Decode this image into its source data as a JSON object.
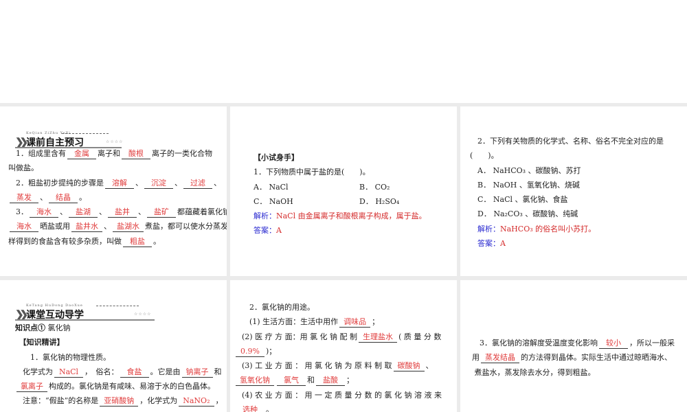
{
  "panels": [
    {
      "id": "preview",
      "header": {
        "pinyin": "KeQian ZiZhu YuXi",
        "title": "课前自主预习",
        "stars": "☆☆☆☆"
      },
      "lines": [
        [
          {
            "t": "　1．组成里含有"
          },
          {
            "b": "金属"
          },
          {
            "t": "离子和"
          },
          {
            "b": "酸根"
          },
          {
            "t": "离子的一类化合物"
          }
        ],
        [
          {
            "t": "叫做盐。"
          }
        ],
        [
          {
            "t": "　2．粗盐初步提纯的步骤是"
          },
          {
            "b": "溶解"
          },
          {
            "t": "、"
          },
          {
            "b": "沉淀"
          },
          {
            "t": "、"
          },
          {
            "b": "过滤"
          },
          {
            "t": "、"
          }
        ],
        [
          {
            "b": "蒸发"
          },
          {
            "t": "、"
          },
          {
            "b": "结晶"
          },
          {
            "t": "。"
          }
        ],
        [
          {
            "t": "　3．"
          },
          {
            "b": "海水"
          },
          {
            "t": "、"
          },
          {
            "b": "盐湖"
          },
          {
            "t": "、"
          },
          {
            "b": "盐井"
          },
          {
            "t": "、"
          },
          {
            "b": "盐矿"
          },
          {
            "t": "都蕴藏着氯化钠，用"
          }
        ],
        [
          {
            "b": "海水"
          },
          {
            "t": "晒盐或用"
          },
          {
            "b": "盐井水"
          },
          {
            "t": "、"
          },
          {
            "b": "盐湖水"
          },
          {
            "t": "煮盐，都可以使水分蒸发，这"
          }
        ],
        [
          {
            "t": "样得到的食盐含有较多杂质，叫做"
          },
          {
            "b": "粗盐"
          },
          {
            "t": "。"
          }
        ]
      ]
    },
    {
      "id": "practice-1",
      "lines": [
        [
          {
            "t": "【小试身手】",
            "c": "bold"
          }
        ],
        [
          {
            "t": "1．下列物质中属于盐的是(　　)。"
          }
        ],
        [
          {
            "t": "A． NaCl"
          },
          {
            "t": "B． CO₂",
            "tab": true
          }
        ],
        [
          {
            "t": "C． NaOH"
          },
          {
            "t": "D． H₂SO₄",
            "tab": true
          }
        ],
        [
          {
            "t": "解析：",
            "c": "blue"
          },
          {
            "t": "NaCl 由金属离子和酸根离子构成，属于盐。",
            "c": "red"
          }
        ],
        [
          {
            "t": "答案：",
            "c": "blue"
          },
          {
            "t": "A",
            "c": "red"
          }
        ]
      ]
    },
    {
      "id": "practice-2",
      "lines": [
        [
          {
            "t": "　2．下列有关物质的化学式、名称、俗名不完全对应的是"
          }
        ],
        [
          {
            "t": "(　　)。"
          }
        ],
        [
          {
            "t": "　A． NaHCO₃ 、碳酸钠、苏打"
          }
        ],
        [
          {
            "t": "　B． NaOH 、氢氧化钠、烧碱"
          }
        ],
        [
          {
            "t": "　C． NaCl 、氯化钠、食盐"
          }
        ],
        [
          {
            "t": "　D． Na₂CO₃ 、碳酸钠、纯碱"
          }
        ],
        [
          {
            "t": "　解析：",
            "c": "blue"
          },
          {
            "t": "NaHCO₃ 的俗名叫小苏打。",
            "c": "red"
          }
        ],
        [
          {
            "t": "　答案：",
            "c": "blue"
          },
          {
            "t": "A",
            "c": "red"
          }
        ]
      ]
    },
    {
      "id": "classroom",
      "header": {
        "pinyin": "KeTang HuDong DaoXue",
        "title": "课堂互动导学",
        "stars": "☆☆☆☆"
      },
      "lines": [
        [
          {
            "t": "知识点①",
            "c": "bold"
          },
          {
            "t": " 氯化钠"
          }
        ],
        [
          {
            "t": "　【知识精讲】",
            "c": "bold"
          }
        ],
        [
          {
            "t": "　　1．氯化钠的物理性质。"
          }
        ],
        [
          {
            "t": "　化学式为"
          },
          {
            "b": "NaCl"
          },
          {
            "t": "，　俗名："
          },
          {
            "b": "食盐"
          },
          {
            "t": "。它是由"
          },
          {
            "b": "钠离子"
          },
          {
            "t": "和"
          }
        ],
        [
          {
            "b": "氯离子"
          },
          {
            "t": "构成的。氯化钠是有咸味、易溶于水的白色晶体。"
          }
        ],
        [
          {
            "t": "　注意：“假盐”的名称是"
          },
          {
            "b": "亚硝酸钠"
          },
          {
            "t": "，化学式为"
          },
          {
            "b": "NaNO₂"
          },
          {
            "t": "，"
          }
        ]
      ]
    },
    {
      "id": "uses",
      "lines": [
        [
          {
            "t": "　　2．氯化钠的用途。"
          }
        ],
        [
          {
            "t": "　　(1) 生活方面：生活中用作"
          },
          {
            "b": "调味品"
          },
          {
            "t": "；"
          }
        ],
        [
          {
            "t": "　(2) 医 疗 方 面：用 氯 化 钠 配 制"
          },
          {
            "b": "生理盐水"
          },
          {
            "t": "( 质 量 分 数"
          }
        ],
        [
          {
            "b": "0.9%"
          },
          {
            "t": ")；"
          }
        ],
        [
          {
            "t": "　(3) 工 业 方 面 ： 用 氯 化 钠 为 原 料 制 取"
          },
          {
            "b": "碳酸钠"
          },
          {
            "t": "、"
          }
        ],
        [
          {
            "b": "氢氧化钠"
          },
          {
            "b": "氯气"
          },
          {
            "t": "和"
          },
          {
            "b": "盐酸"
          },
          {
            "t": "；"
          }
        ],
        [
          {
            "t": "　(4) 农 业 方 面 ： 用 一 定 质 量 分 数 的 氯 化 钠 溶 液 来"
          }
        ],
        [
          {
            "b": "选种"
          },
          {
            "t": "。"
          }
        ]
      ]
    },
    {
      "id": "solubility",
      "lines": [
        [
          {
            "t": "　　3．氯化钠的溶解度受温度变化影响"
          },
          {
            "b": "较小"
          },
          {
            "t": "，所以一般采"
          }
        ],
        [
          {
            "t": "　用"
          },
          {
            "b": "蒸发结晶"
          },
          {
            "t": "的方法得到晶体。实际生活中通过晾晒海水、"
          }
        ],
        [
          {
            "t": "　 煮盐水，蒸发除去水分，得到粗盐。"
          }
        ]
      ]
    }
  ]
}
